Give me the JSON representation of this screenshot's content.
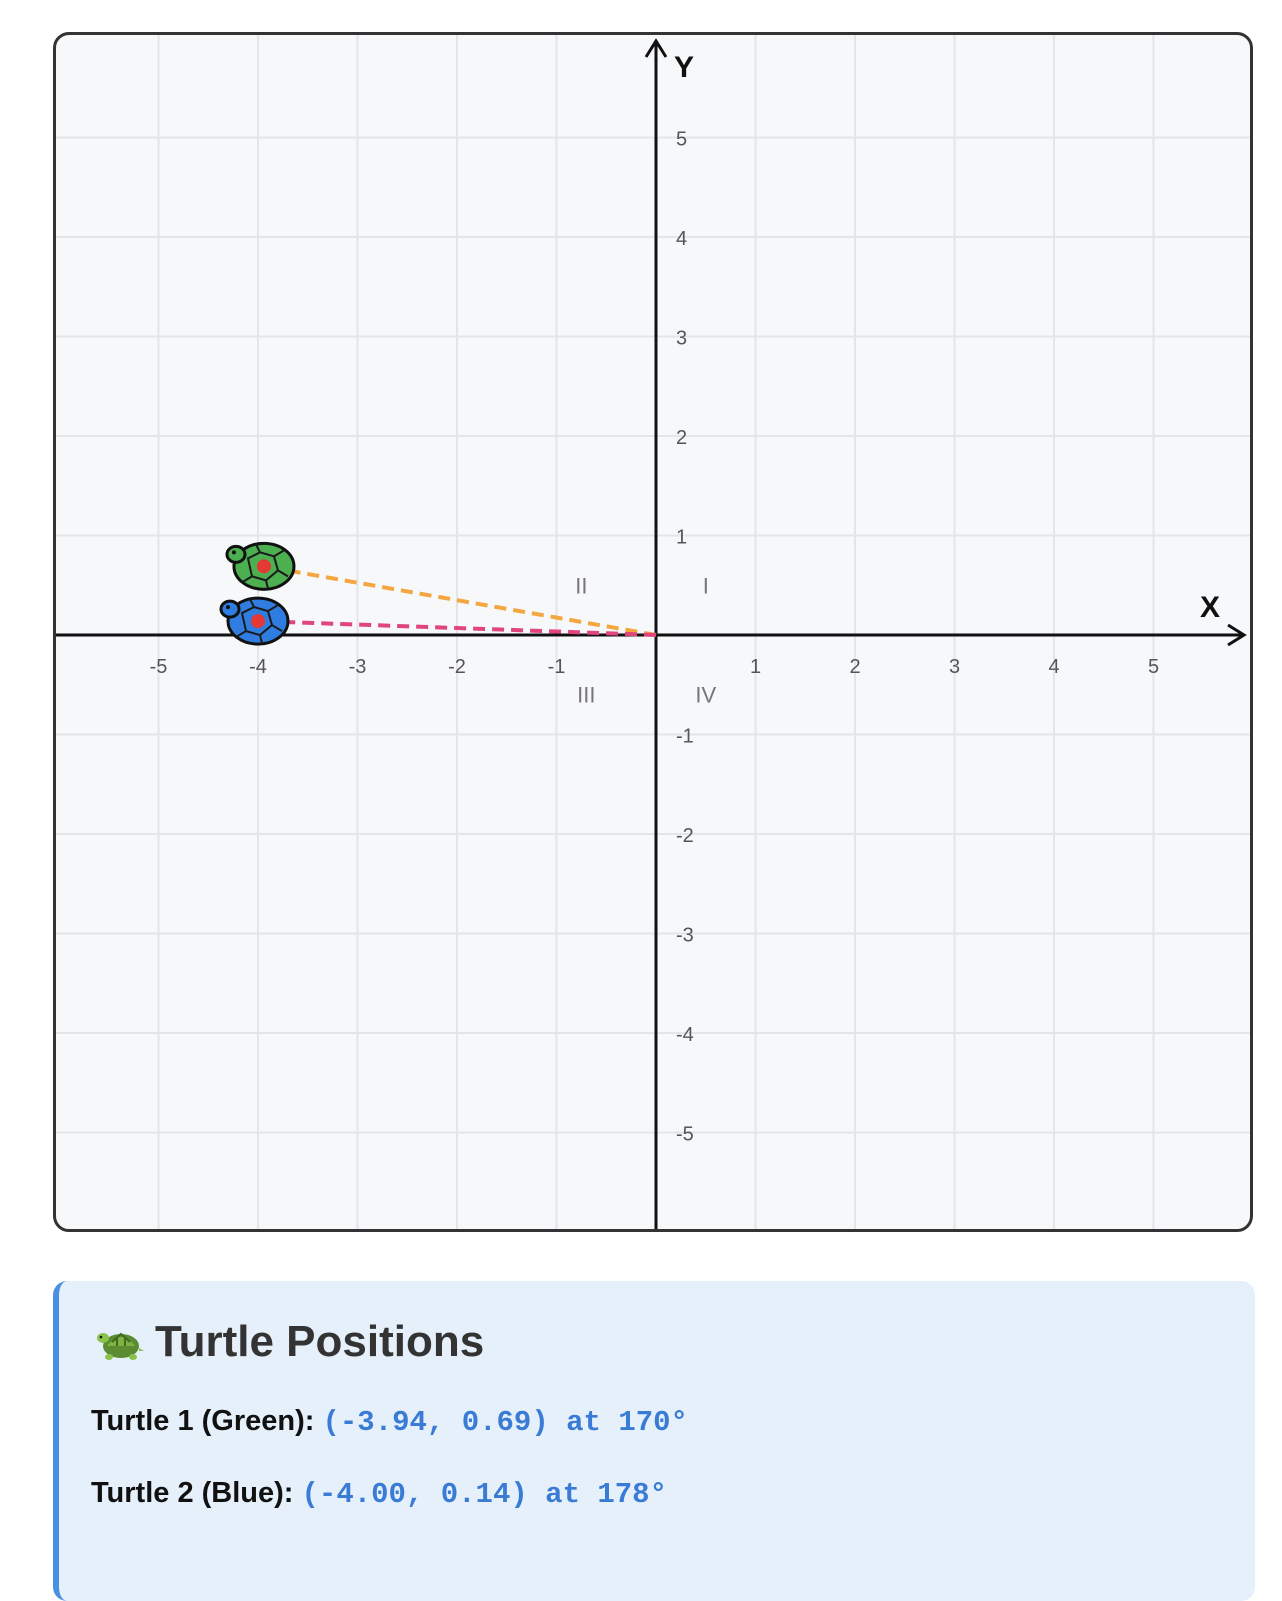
{
  "plane": {
    "x_axis_label": "X",
    "y_axis_label": "Y",
    "x_range": [
      -6,
      6
    ],
    "y_range": [
      -6,
      6
    ],
    "x_ticks": [
      "-5",
      "-4",
      "-3",
      "-2",
      "-1",
      "1",
      "2",
      "3",
      "4",
      "5"
    ],
    "y_ticks": [
      "5",
      "4",
      "3",
      "2",
      "1",
      "-1",
      "-2",
      "-3",
      "-4",
      "-5"
    ],
    "quadrants": [
      "I",
      "II",
      "III",
      "IV"
    ],
    "grid": true,
    "colors": {
      "grid": "#e3e5e8",
      "axis": "#111111",
      "background": "#f7f8fa",
      "turtle1_line": "#f4a640",
      "turtle2_line": "#e0457b",
      "green_shell": "#4caf50",
      "blue_shell": "#2f7de1",
      "center_dot": "#e53935"
    }
  },
  "turtles": [
    {
      "name": "Turtle 1 (Green)",
      "x": -3.94,
      "y": 0.69,
      "heading": 170,
      "color": "green"
    },
    {
      "name": "Turtle 2 (Blue)",
      "x": -4.0,
      "y": 0.14,
      "heading": 178,
      "color": "blue"
    }
  ],
  "info": {
    "title": "Turtle Positions",
    "icon": "turtle-icon",
    "turtle1_label": "Turtle 1 (Green):",
    "turtle1_value": "(-3.94, 0.69) at 170°",
    "turtle2_label": "Turtle 2 (Blue):",
    "turtle2_value": "(-4.00, 0.14) at 178°"
  }
}
